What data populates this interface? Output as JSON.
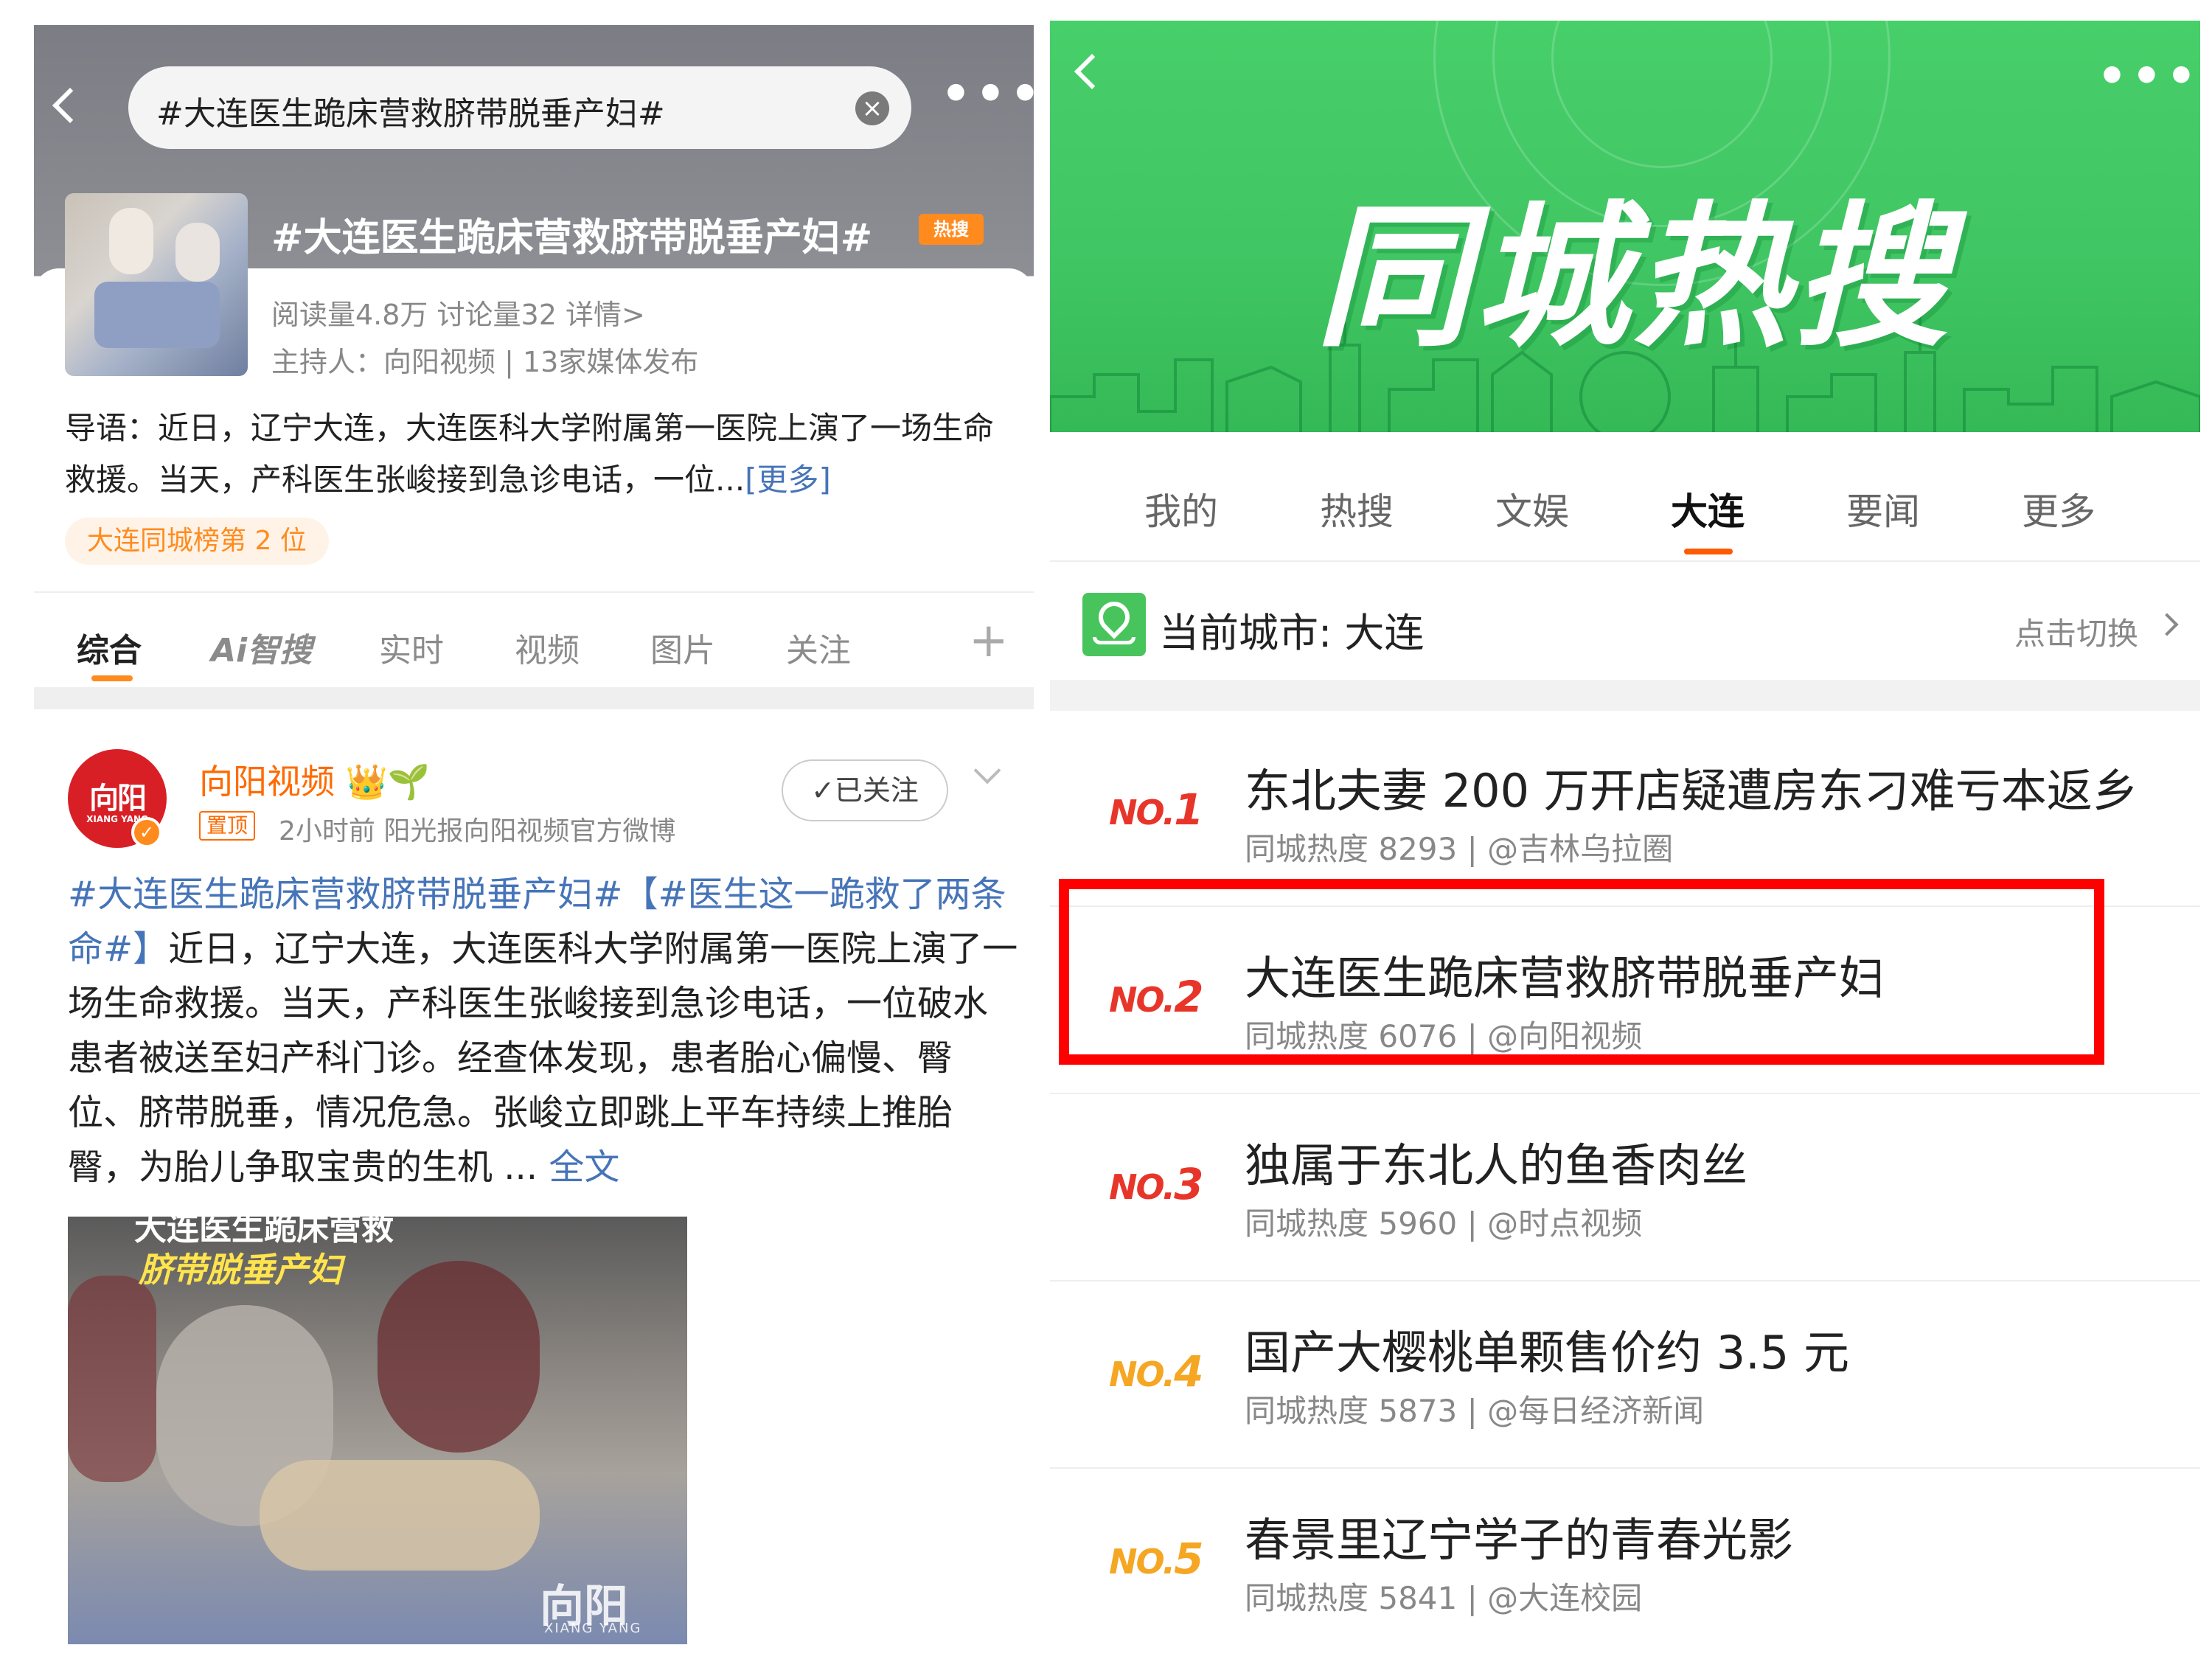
{
  "left": {
    "search_text": "#大连医生跪床营救脐带脱垂产妇#",
    "clear_icon": "×",
    "more_icon": "•••",
    "topic_title": "#大连医生跪床营救脐带脱垂产妇#",
    "hot_badge": "热搜",
    "stats_line": "阅读量4.8万   讨论量32   详情>",
    "host_line": "主持人：向阳视频 | 13家媒体发布",
    "intro_text": "导语：近日，辽宁大连，大连医科大学附属第一医院上演了一场生命救援。当天，产科医生张峻接到急诊电话，一位...",
    "intro_more": "[更多]",
    "rank_chip": "大连同城榜第 2 位",
    "tabs": [
      "综合",
      "Ai智搜",
      "实时",
      "视频",
      "图片",
      "关注"
    ],
    "plus_icon": "+",
    "post": {
      "avatar_text": "向阳",
      "avatar_sub": "XIANG YANG",
      "author": "向阳视频 👑🌱",
      "pinned": "置顶",
      "meta": "2小时前  阳光报向阳视频官方微博",
      "follow": "✓已关注",
      "tag": "#大连医生跪床营救脐带脱垂产妇#",
      "tag2": "【#医生这一跪救了两条命#】",
      "body": "近日，辽宁大连，大连医科大学附属第一医院上演了一场生命救援。当天，产科医生张峻接到急诊电话，一位破水患者被送至妇产科门诊。经查体发现，患者胎心偏慢、臀位、脐带脱垂，情况危急。张峻立即跳上平车持续上推胎臀，为胎儿争取宝贵的生机 ...",
      "full": "全文",
      "video_caption1": "大连医生跪床营救",
      "video_caption2": "脐带脱垂产妇",
      "video_logo": "向阳",
      "video_logo_sub": "XIANG YANG"
    }
  },
  "right": {
    "banner_title": "同城热搜",
    "more_icon": "•••",
    "tabs": [
      "我的",
      "热搜",
      "文娱",
      "大连",
      "要闻",
      "更多"
    ],
    "active_tab": "大连",
    "city_label": "当前城市: 大连",
    "switch_label": "点击切换",
    "items": [
      {
        "no": "NO.",
        "rank": "1",
        "title": "东北夫妻 200 万开店疑遭房东刁难亏本返乡",
        "sub": "同城热度 8293 | @吉林乌拉圈",
        "color": "#e8352a"
      },
      {
        "no": "NO.",
        "rank": "2",
        "title": "大连医生跪床营救脐带脱垂产妇",
        "sub": "同城热度 6076 | @向阳视频",
        "color": "#e8352a"
      },
      {
        "no": "NO.",
        "rank": "3",
        "title": "独属于东北人的鱼香肉丝",
        "sub": "同城热度 5960 | @时点视频",
        "color": "#e8352a"
      },
      {
        "no": "NO.",
        "rank": "4",
        "title": "国产大樱桃单颗售价约 3.5 元",
        "sub": "同城热度 5873 | @每日经济新闻",
        "color": "#f5a623"
      },
      {
        "no": "NO.",
        "rank": "5",
        "title": "春景里辽宁学子的青春光影",
        "sub": "同城热度 5841 | @大连校园",
        "color": "#f5a623"
      }
    ]
  }
}
